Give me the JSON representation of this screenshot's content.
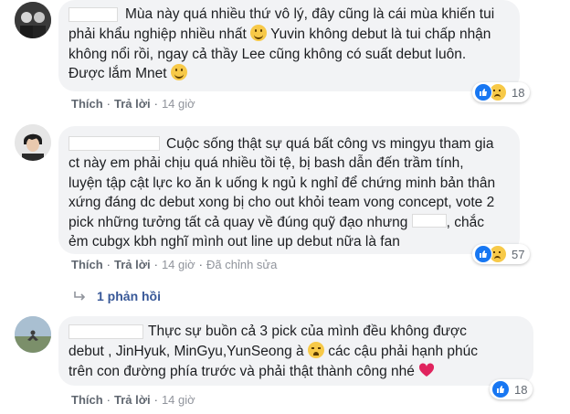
{
  "comments": [
    {
      "lines": [
        "Mùa này quá nhiều thứ vô lý, đây cũng là cái mùa khiến tui",
        "phải khẩu nghiệp nhiều nhất",
        "không nổi rồi, ngay cả thầy Lee cũng không có suất debut luôn.",
        "Được lắm Mnet"
      ],
      "line2_tail": "Yuvin không debut là tui chấp nhận",
      "actions": {
        "like": "Thích",
        "reply": "Trả lời",
        "time": "14 giờ"
      },
      "reaction_count": "18"
    },
    {
      "lines": [
        "Cuộc sống thật sự quá bất công vs mingyu tham gia",
        "ct này em phải chịu quá nhiều tồi tệ, bị bash dẫn đến trầm tính,",
        "luyện tập cật lực ko ăn k uống k ngủ k nghỉ để chứng minh bản thân",
        "xứng đáng dc debut xong bị cho out khỏi team vong concept, vote 2",
        "pick những tưởng tất cả quay về đúng quỹ đạo nhưng",
        "ẻm cubgx kbh nghĩ mình out line up debut nữa là fan"
      ],
      "line5_tail": ", chắc",
      "actions": {
        "like": "Thích",
        "reply": "Trả lời",
        "time": "14 giờ",
        "edited": "Đã chỉnh sửa"
      },
      "reaction_count": "57",
      "replies_label": "1 phản hồi"
    },
    {
      "lines": [
        "Thực sự buồn cả 3 pick của mình đều không được",
        "debut , JinHyuk, MinGyu,YunSeong à",
        "các cậu phải hạnh phúc",
        "trên con đường phía trước và phải thật thành công nhé"
      ],
      "actions": {
        "like": "Thích",
        "reply": "Trả lời",
        "time": "14 giờ"
      },
      "reaction_count": "18"
    }
  ],
  "colors": {
    "bubble": "#f2f3f5",
    "link": "#385898",
    "like": "#1877f2",
    "meta": "#606770"
  },
  "icons": [
    "smile-emoji-icon",
    "crying-emoji-icon",
    "heart-emoji-icon",
    "like-reaction-icon",
    "sad-reaction-icon",
    "reply-arrow-icon"
  ]
}
